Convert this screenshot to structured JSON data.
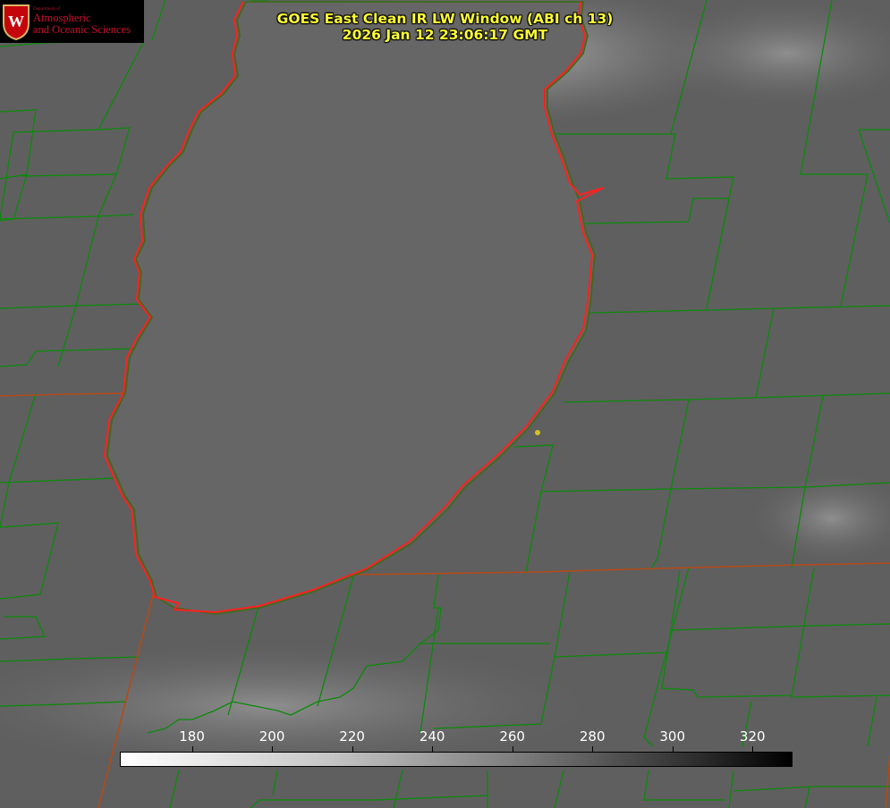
{
  "title": {
    "line1": "GOES East Clean IR LW Window (ABI ch 13)",
    "line2": "2026 Jan 12 23:06:17 GMT"
  },
  "logo": {
    "dept": "Department of",
    "line1": "Atmospheric",
    "line2": "and Oceanic Sciences",
    "seal_letter": "W",
    "icon": "uw-crest-icon"
  },
  "colorbar": {
    "ticks": [
      "180",
      "200",
      "220",
      "240",
      "260",
      "280",
      "300",
      "320"
    ],
    "tick_values": [
      180,
      200,
      220,
      240,
      260,
      280,
      300,
      320
    ],
    "range": [
      162,
      330
    ],
    "gradient": "white-to-black"
  },
  "colors": {
    "title": "#ffff33",
    "county_lines": "#0b8a0b",
    "state_lines": "#b34a1a",
    "lake_shore": "#ff2020",
    "station_marker": "#d4c21e",
    "background": "#5e5e5e",
    "lake_fill": "#666666"
  }
}
